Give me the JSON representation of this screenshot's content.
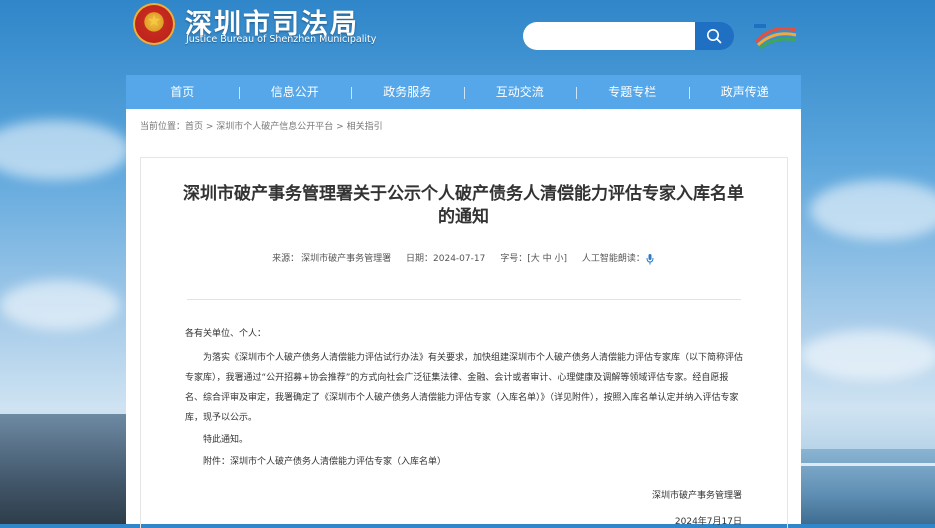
{
  "header": {
    "site_name": "深圳市司法局",
    "site_name_en": "Justice Bureau of Shenzhen Municipality",
    "search_placeholder": ""
  },
  "nav": {
    "items": [
      "首页",
      "信息公开",
      "政务服务",
      "互动交流",
      "专题专栏",
      "政声传递"
    ]
  },
  "breadcrumb": {
    "prefix": "当前位置：",
    "items": [
      "首页",
      "深圳市个人破产信息公开平台",
      "相关指引"
    ],
    "sep": " > "
  },
  "article": {
    "title": "深圳市破产事务管理署关于公示个人破产债务人清偿能力评估专家入库名单的通知",
    "source_label": "来源：",
    "source": "深圳市破产事务管理署",
    "date_label": "日期：",
    "date": "2024-07-17",
    "font_label": "字号：",
    "font_sizes": "[大 中 小]",
    "tts_label": "人工智能朗读：",
    "salutation": "各有关单位、个人：",
    "para1": "为落实《深圳市个人破产债务人清偿能力评估试行办法》有关要求，加快组建深圳市个人破产债务人清偿能力评估专家库（以下简称评估专家库），我署通过“公开招募+协会推荐”的方式向社会广泛征集法律、金融、会计或者审计、心理健康及调解等领域评估专家。经自愿报名、综合评审及审定，我署确定了《深圳市个人破产债务人清偿能力评估专家（入库名单）》（详见附件），按照入库名单认定并纳入评估专家库，现予以公示。",
    "para2": "特此通知。",
    "attachment": "附件：深圳市个人破产债务人清偿能力评估专家（入库名单）",
    "signature": "深圳市破产事务管理署",
    "sign_date": "2024年7月17日"
  },
  "colors": {
    "nav": "#55a7e9",
    "search_button": "#1f6fc2"
  }
}
